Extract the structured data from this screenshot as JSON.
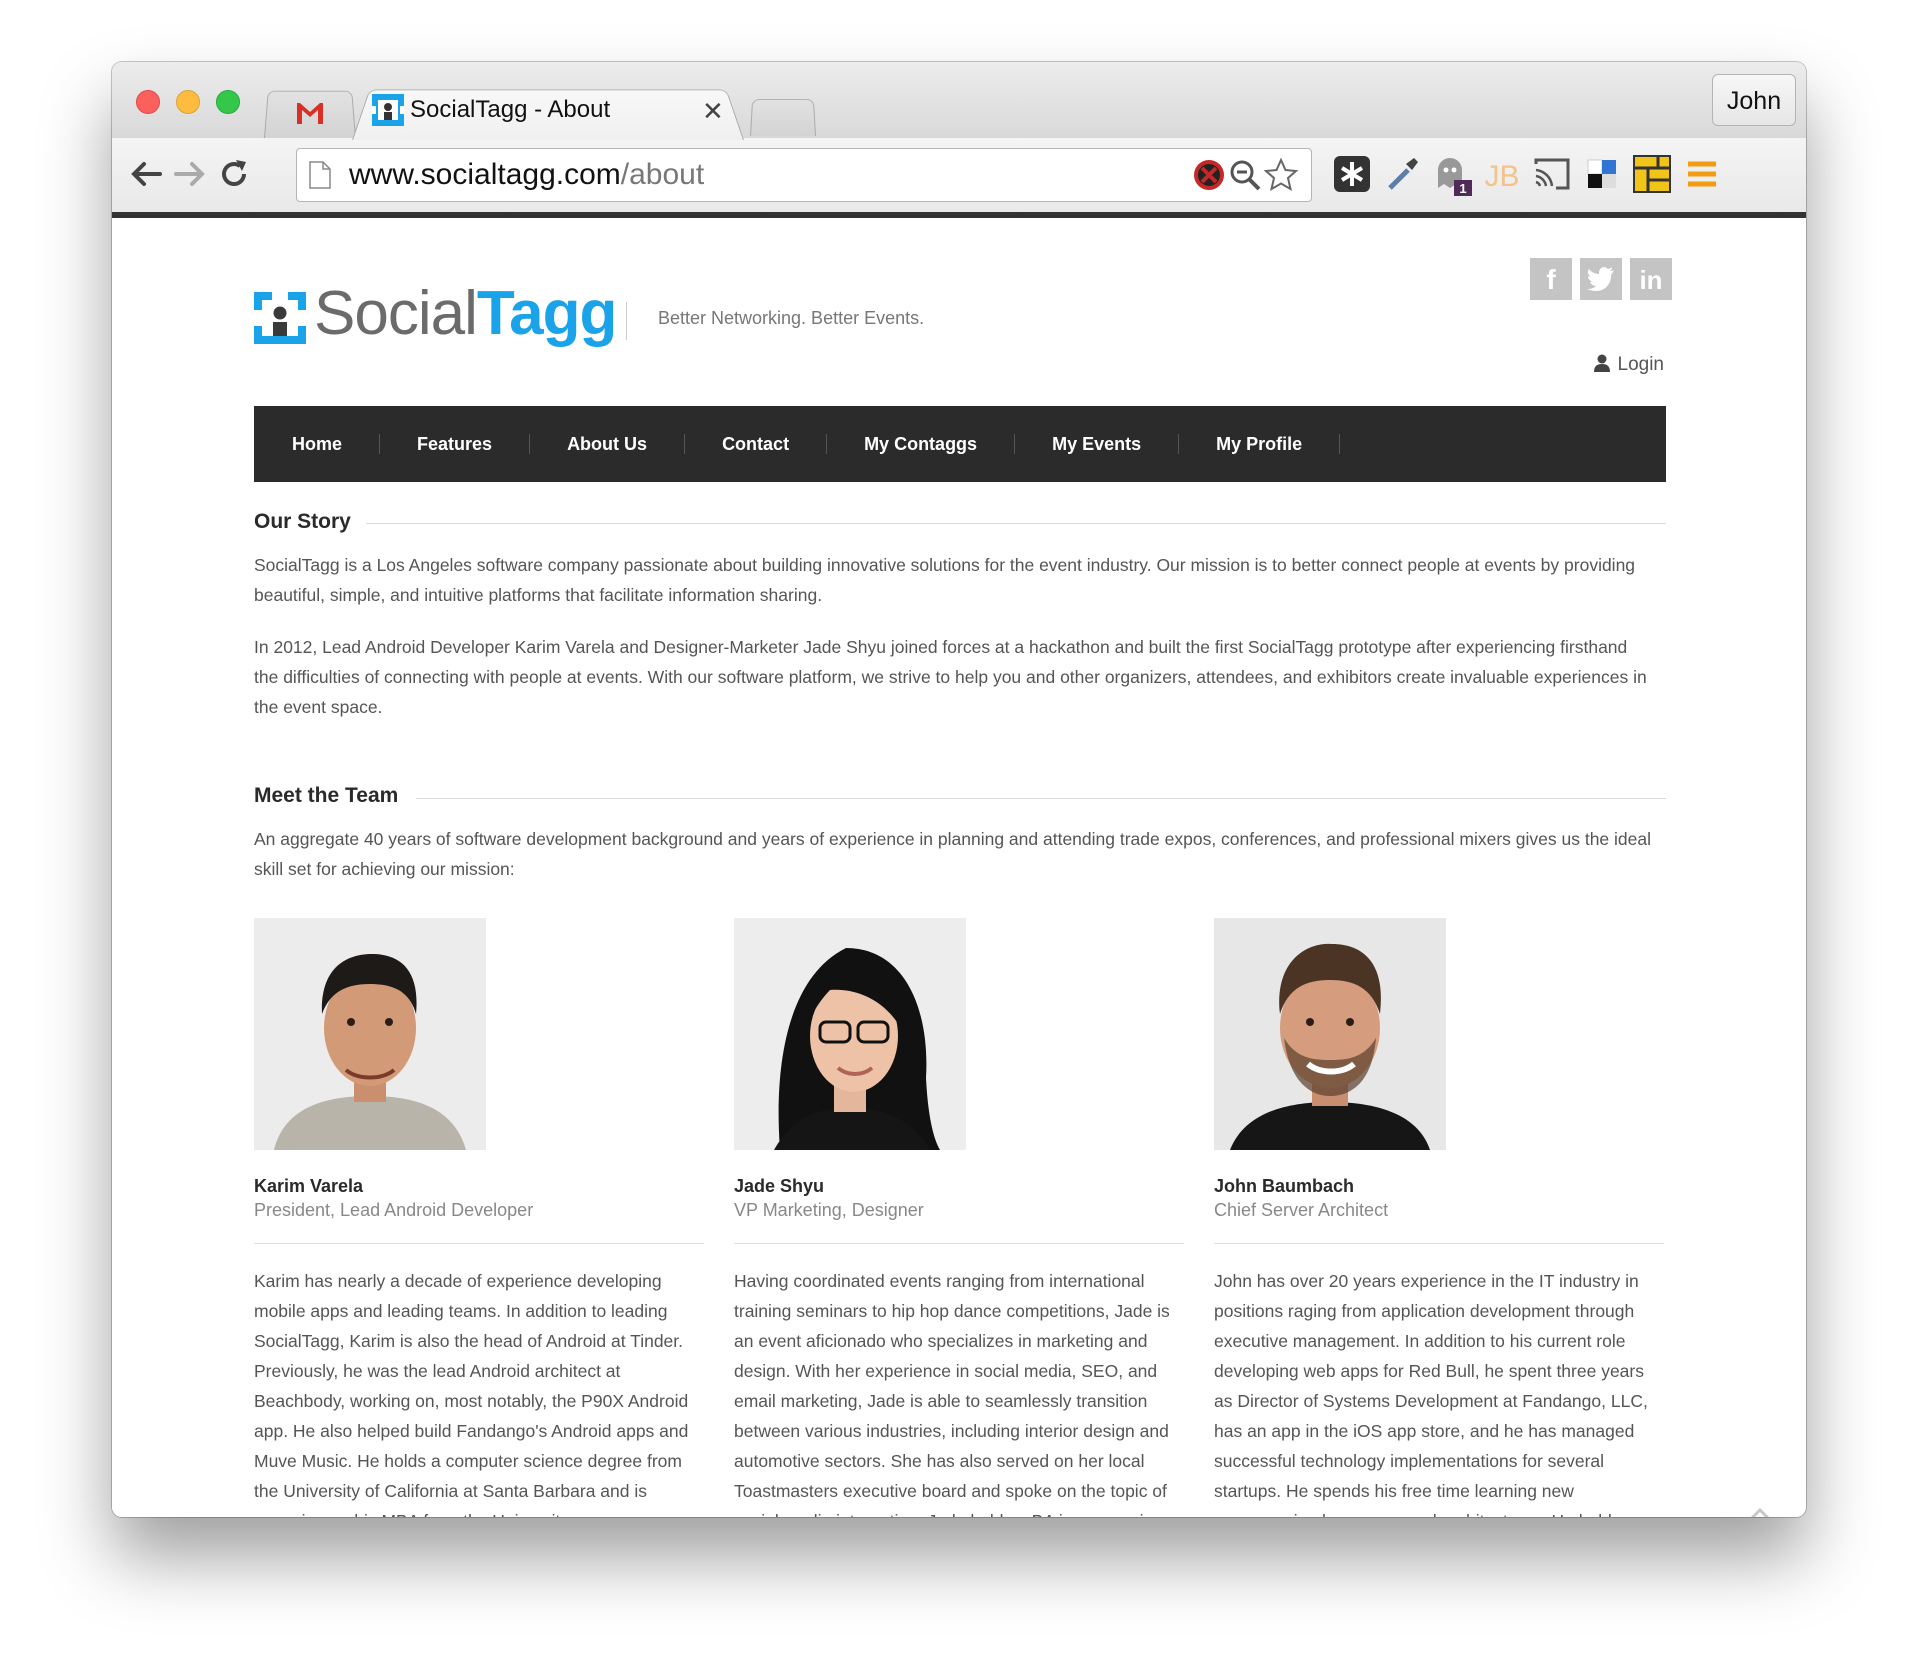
{
  "browser": {
    "tabs": [
      {
        "label": "",
        "icon": "gmail-icon"
      },
      {
        "label": "SocialTagg - About",
        "icon": "socialtagg-favicon",
        "active": true
      }
    ],
    "profile_name": "John",
    "url_host": "www.socialtagg.com",
    "url_path": "/about",
    "extension_badge": "1",
    "extension_jb": "JB"
  },
  "site": {
    "logo_social": "Social",
    "logo_tagg": "Tagg",
    "tagline": "Better Networking. Better Events.",
    "social_links": [
      "f",
      "t",
      "in"
    ],
    "login_label": "Login",
    "nav": [
      "Home",
      "Features",
      "About Us",
      "Contact",
      "My Contaggs",
      "My Events",
      "My Profile"
    ]
  },
  "story": {
    "heading": "Our Story",
    "p1": "SocialTagg is a Los Angeles software company passionate about building innovative solutions for the event industry. Our mission is to better connect people at events by providing beautiful, simple, and intuitive platforms that facilitate information sharing.",
    "p2": "In 2012, Lead Android Developer Karim Varela and Designer-Marketer Jade Shyu joined forces at a hackathon and built the first SocialTagg prototype after experiencing firsthand the difficulties of connecting with people at events. With our software platform, we strive to help you and other organizers, attendees, and exhibitors create invaluable experiences in the event space."
  },
  "team": {
    "heading": "Meet the Team",
    "intro": "An aggregate 40 years of software development background and years of experience in planning and attending trade expos, conferences, and professional mixers gives us the ideal skill set for achieving our mission:",
    "members": [
      {
        "name": "Karim Varela",
        "role": "President, Lead Android Developer",
        "bio": "Karim has nearly a decade of experience developing mobile apps and leading teams. In addition to leading SocialTagg, Karim is also the head of Android at Tinder. Previously, he was the lead Android architect at Beachbody, working on, most notably, the P90X Android app. He also helped build Fandango's Android apps and Muve Music. He holds a computer science degree from the University of California at Santa Barbara and is wrapping up his MBA from the University"
      },
      {
        "name": "Jade Shyu",
        "role": "VP Marketing, Designer",
        "bio": "Having coordinated events ranging from international training seminars to hip hop dance competitions, Jade is an event aficionado who specializes in marketing and design. With her experience in social media, SEO, and email marketing, Jade is able to seamlessly transition between various industries, including interior design and automotive sectors. She has also served on her local Toastmasters executive board and spoke on the topic of social media integration. Jade holds a BA in economics"
      },
      {
        "name": "John Baumbach",
        "role": "Chief Server Architect",
        "bio": "John has over 20 years experience in the IT industry in positions raging from application development through executive management. In addition to his current role developing web apps for Red Bull, he spent three years as Director of Systems Development at Fandango, LLC, has an app in the iOS app store, and he has managed successful technology implementations for several startups. He spends his free time learning new programming languages and architectures. He holds a"
      }
    ]
  }
}
